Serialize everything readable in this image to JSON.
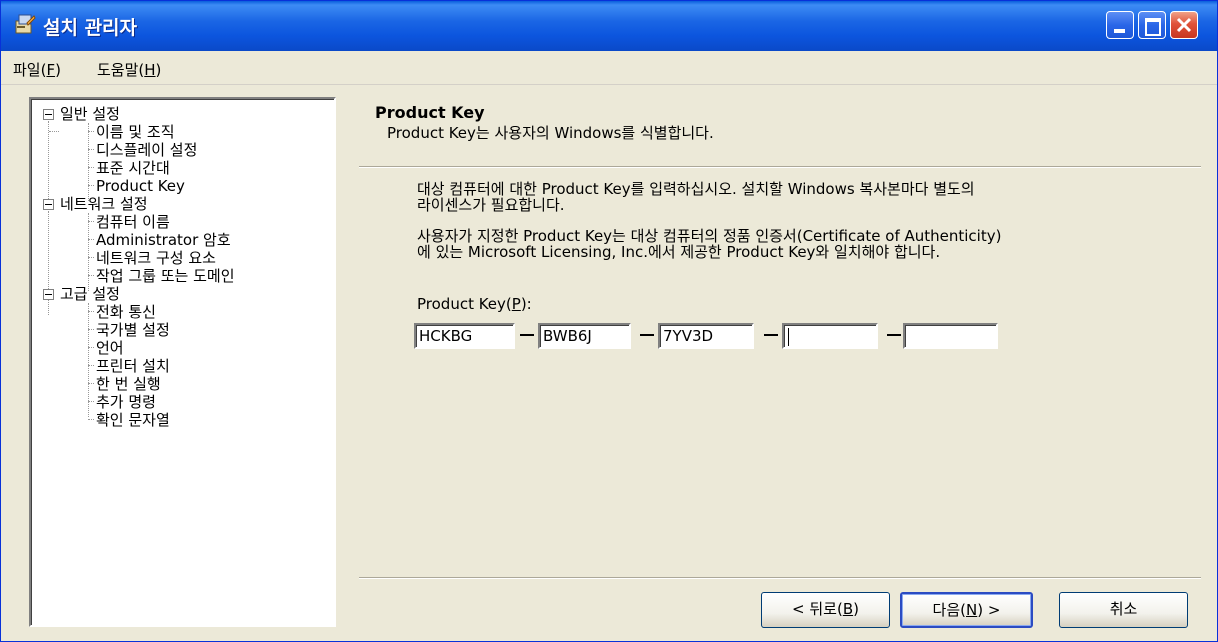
{
  "window": {
    "title": "설치 관리자",
    "controls": [
      "minimize",
      "maximize",
      "close"
    ]
  },
  "menubar": {
    "file": {
      "text": "파일(",
      "key": "F",
      "end": ")"
    },
    "help": {
      "text": "도움말(",
      "key": "H",
      "end": ")"
    }
  },
  "tree": {
    "groups": [
      {
        "label": "일반 설정",
        "items": [
          "이름 및 조직",
          "디스플레이 설정",
          "표준 시간대",
          "Product Key"
        ]
      },
      {
        "label": "네트워크 설정",
        "items": [
          "컴퓨터 이름",
          "Administrator 암호",
          "네트워크 구성 요소",
          "작업 그룹 또는 도메인"
        ]
      },
      {
        "label": "고급 설정",
        "items": [
          "전화 통신",
          "국가별 설정",
          "언어",
          "프린터 설치",
          "한 번 실행",
          "추가 명령",
          "확인 문자열"
        ]
      }
    ],
    "selected": "Product Key"
  },
  "page": {
    "heading": "Product Key",
    "subheading": "Product Key는 사용자의 Windows를 식별합니다.",
    "paragraph1_line1": "대상 컴퓨터에 대한 Product Key를 입력하십시오. 설치할 Windows 복사본마다 별도의",
    "paragraph1_line2": "라이센스가 필요합니다.",
    "paragraph2_line1": "사용자가 지정한 Product Key는 대상 컴퓨터의 정품 인증서(Certificate of Authenticity)",
    "paragraph2_line2": "에 있는 Microsoft Licensing, Inc.에서 제공한 Product Key와 일치해야 합니다.",
    "product_key_label": {
      "text": "Product Key(",
      "key": "P",
      "end": "):"
    },
    "product_key_fields": [
      "HCKBG",
      "BWB6J",
      "7YV3D",
      "",
      ""
    ]
  },
  "buttons": {
    "back": {
      "text": "< 뒤로(",
      "key": "B",
      "end": ")"
    },
    "next": {
      "text": "다음(",
      "key": "N",
      "end": ") >"
    },
    "cancel": "취소"
  }
}
